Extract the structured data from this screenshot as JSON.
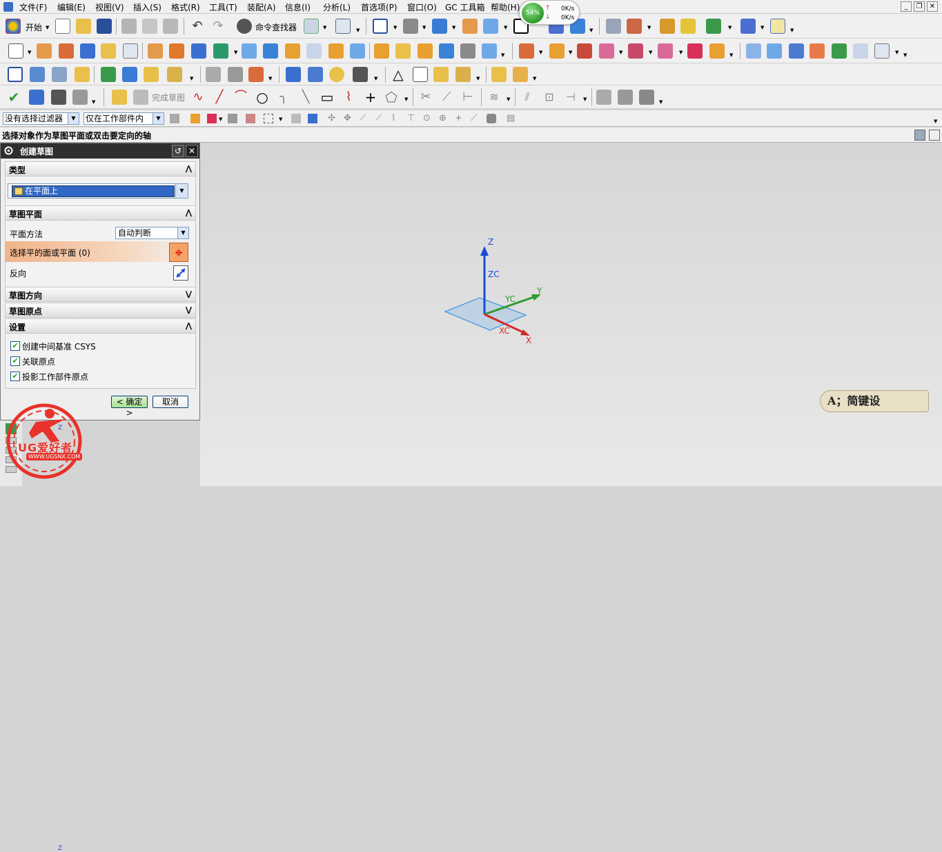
{
  "menubar": {
    "items": [
      "文件(F)",
      "编辑(E)",
      "视图(V)",
      "插入(S)",
      "格式(R)",
      "工具(T)",
      "装配(A)",
      "信息(I)",
      "分析(L)",
      "首选项(P)",
      "窗口(O)",
      "GC 工具箱",
      "帮助(H)"
    ]
  },
  "netmeter": {
    "percent": "54%",
    "up": "0K/s",
    "down": "0K/s"
  },
  "toolbar": {
    "start_label": "开始",
    "cmd_finder": "命令查找器",
    "finish_sketch": "完成草图"
  },
  "filterbar": {
    "filter_value": "没有选择过滤器",
    "scope_value": "仅在工作部件内"
  },
  "status": {
    "prompt": "选择对象作为草图平面或双击要定向的轴"
  },
  "dialog": {
    "title": "创建草图",
    "sections": {
      "type": "类型",
      "sketch_plane": "草图平面",
      "sketch_direction": "草图方向",
      "sketch_origin": "草图原点",
      "settings": "设置"
    },
    "type_value": "在平面上",
    "plane_method_label": "平面方法",
    "plane_method_value": "自动判断",
    "select_face_label": "选择平的面或平面 (0)",
    "reverse_label": "反向",
    "checkboxes": [
      "创建中间基准 CSYS",
      "关联原点",
      "投影工作部件原点"
    ],
    "ok_label": "< 确定 >",
    "cancel_label": "取消"
  },
  "triad": {
    "z": "Z",
    "zc": "ZC",
    "y": "Y",
    "yc": "YC",
    "x": "X",
    "xc": "XC"
  },
  "mini_axis": {
    "z": "Z"
  },
  "watermark": {
    "name": "UG爱好者",
    "url": "WWW.UGSNX.COM"
  },
  "brand": {
    "text": "A；简键设"
  },
  "colors": {
    "axis_z": "#1a4ad6",
    "axis_y": "#2c9a2c",
    "axis_x": "#d22a2a",
    "plane": "#2f8fe0",
    "dialog_title": "#2f2f2f"
  }
}
